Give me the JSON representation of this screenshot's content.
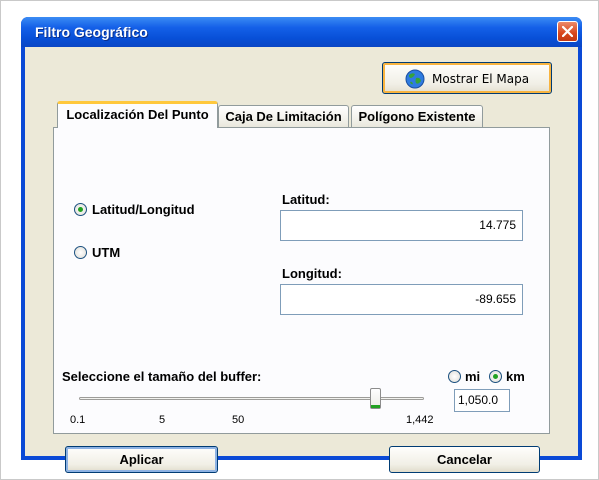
{
  "window": {
    "title": "Filtro Geográfico"
  },
  "map_button": {
    "label": "Mostrar El Mapa"
  },
  "tabs": [
    {
      "label": "Localización Del Punto",
      "active": true
    },
    {
      "label": "Caja De Limitación",
      "active": false
    },
    {
      "label": "Polígono Existente",
      "active": false
    }
  ],
  "coord_mode": {
    "options": [
      {
        "label": "Latitud/Longitud",
        "selected": true
      },
      {
        "label": "UTM",
        "selected": false
      }
    ]
  },
  "latitude": {
    "label": "Latitud:",
    "value": "14.775"
  },
  "longitude": {
    "label": "Longitud:",
    "value": "-89.655"
  },
  "buffer": {
    "label": "Seleccione el tamaño del buffer:",
    "units": [
      {
        "label": "mi",
        "selected": false
      },
      {
        "label": "km",
        "selected": true
      }
    ],
    "slider_ticks": [
      "0.1",
      "5",
      "50",
      "1,442"
    ],
    "slider_fraction": 0.86,
    "value": "1,050.0"
  },
  "buttons": {
    "apply": "Aplicar",
    "cancel": "Cancelar"
  }
}
